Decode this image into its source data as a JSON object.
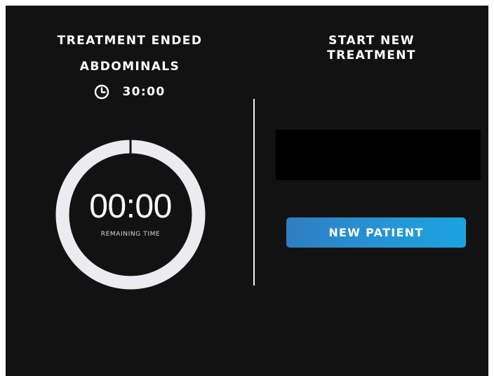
{
  "left": {
    "status_title": "TREATMENT ENDED",
    "area_title": "ABDOMINALS",
    "duration": "30:00",
    "duration_icon": "clock-icon",
    "timer": {
      "value": "00:00",
      "caption": "REMAINING TIME",
      "progress_remaining": 0
    }
  },
  "right": {
    "title_line1": "START NEW",
    "title_line2": "TREATMENT",
    "button_label": "NEW PATIENT"
  },
  "colors": {
    "background": "#121212",
    "text": "#ffffff",
    "ring": "#ebebf0",
    "divider": "#f2f2f2",
    "button_start": "#2f7dc2",
    "button_end": "#1aa3e0",
    "panel_box": "#000000"
  }
}
